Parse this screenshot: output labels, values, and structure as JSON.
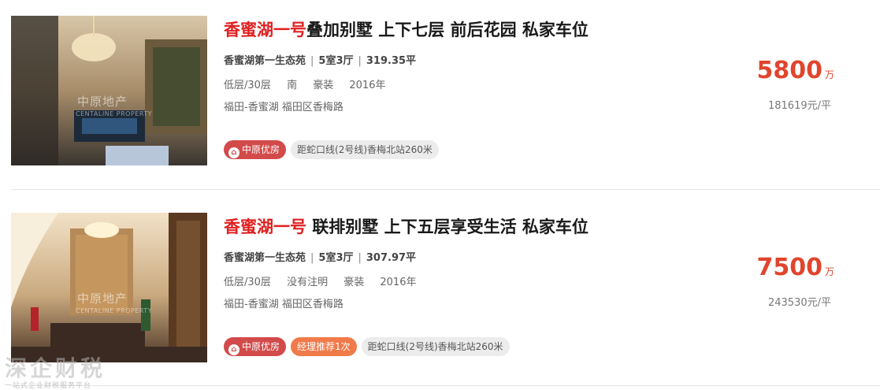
{
  "listings": [
    {
      "title_highlight": "香蜜湖一号",
      "title_rest": "叠加别墅 上下七层 前后花园 私家车位",
      "community": "香蜜湖第一生态苑",
      "layout": "5室3厅",
      "area": "319.35平",
      "floor": "低层/30层",
      "orientation": "南",
      "decoration": "豪装",
      "year": "2016年",
      "address": "福田-香蜜湖 福田区香梅路",
      "tags": [
        "中原优房",
        "距蛇口线(2号线)香梅北站260米"
      ],
      "price": "5800",
      "price_unit": "万",
      "unit_price": "181619元/平",
      "photo_watermark": "中原地产",
      "photo_watermark_en": "CENTALINE PROPERTY"
    },
    {
      "title_highlight": "香蜜湖一号",
      "title_rest": " 联排别墅 上下五层享受生活 私家车位",
      "community": "香蜜湖第一生态苑",
      "layout": "5室3厅",
      "area": "307.97平",
      "floor": "低层/30层",
      "orientation": "没有注明",
      "decoration": "豪装",
      "year": "2016年",
      "address": "福田-香蜜湖 福田区香梅路",
      "tags": [
        "中原优房",
        "经理推荐1次",
        "距蛇口线(2号线)香梅北站260米"
      ],
      "price": "7500",
      "price_unit": "万",
      "unit_price": "243530元/平",
      "photo_watermark": "中原地产",
      "photo_watermark_en": "CENTALINE PROPERTY"
    }
  ],
  "separator": "|",
  "footer_watermark": {
    "main": "深企财税",
    "sub": "一站式企业财税服务平台"
  },
  "colors": {
    "accent_red": "#e02020",
    "price_red": "#e0452d",
    "tag_red": "#d24a4a",
    "tag_orange": "#f07a4a"
  }
}
